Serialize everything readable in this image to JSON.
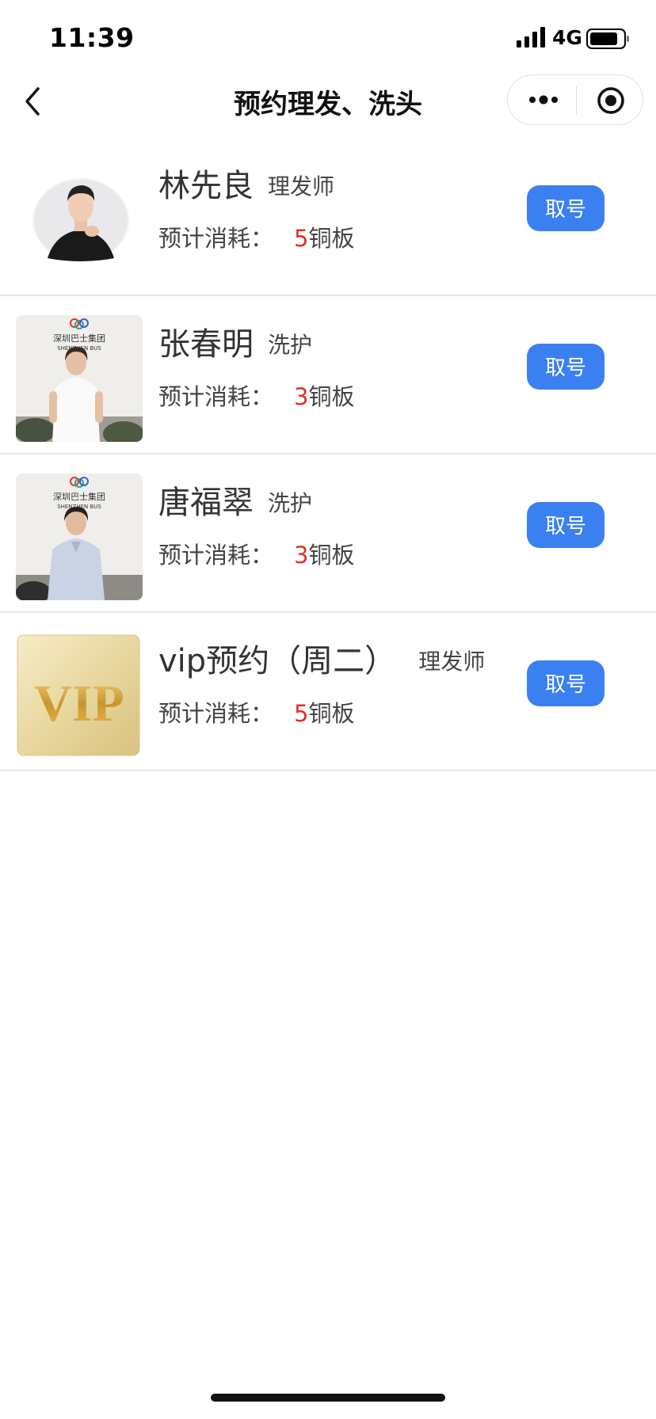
{
  "status_bar": {
    "time": "11:39",
    "network": "4G",
    "signal_icon": "signal-bars-icon",
    "battery_icon": "battery-icon"
  },
  "nav": {
    "title": "预约理发、洗头",
    "back_icon": "chevron-left-icon",
    "more_icon": "more-dots-icon",
    "close_icon": "target-circle-icon"
  },
  "cost_prefix": "预计消耗：",
  "cost_unit": "铜板",
  "button_label": "取号",
  "staff": [
    {
      "name": "林先良",
      "role": "理发师",
      "cost": "5",
      "button": "取号",
      "avatar": "portrait-photo"
    },
    {
      "name": "张春明",
      "role": "洗护",
      "cost": "3",
      "button": "取号",
      "avatar": "portrait-photo",
      "logo_text": "深圳巴士集团",
      "logo_sub": "SHENZHEN BUS"
    },
    {
      "name": "唐福翠",
      "role": "洗护",
      "cost": "3",
      "button": "取号",
      "avatar": "portrait-photo",
      "logo_text": "深圳巴士集团",
      "logo_sub": "SHENZHEN BUS"
    },
    {
      "name": "vip预约（周二）",
      "role": "理发师",
      "cost": "5",
      "button": "取号",
      "avatar": "vip-badge-image",
      "badge_text": "VIP"
    }
  ],
  "colors": {
    "accent": "#3b80f1",
    "cost_red": "#e0302a",
    "divider": "#e6e6e6"
  }
}
